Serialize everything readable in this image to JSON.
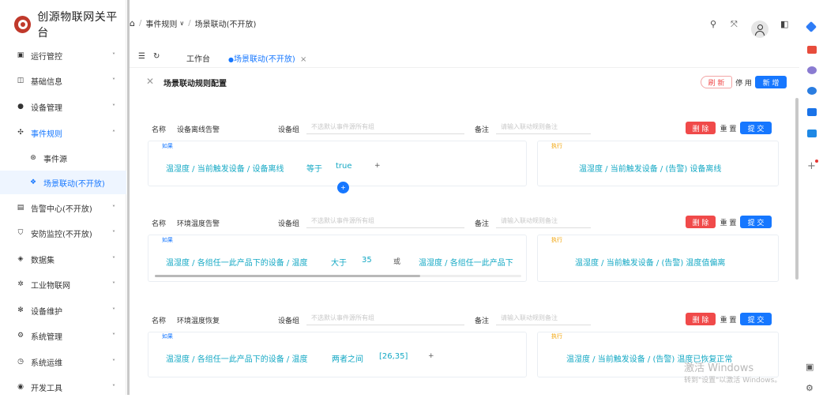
{
  "app": {
    "title": "创源物联网关平台"
  },
  "sidebar": {
    "items": [
      {
        "label": "运行管控",
        "icon": "monitor-icon",
        "chevron": "˅"
      },
      {
        "label": "基础信息",
        "icon": "image-icon",
        "chevron": "˅"
      },
      {
        "label": "设备管理",
        "icon": "device-icon",
        "chevron": "˅"
      },
      {
        "label": "事件规则",
        "icon": "rule-icon",
        "chevron": "˄"
      },
      {
        "label": "事件源",
        "icon": "source-icon",
        "chevron": ""
      },
      {
        "label": "场景联动(不开放)",
        "icon": "scene-icon",
        "chevron": ""
      },
      {
        "label": "告警中心(不开放)",
        "icon": "alarm-icon",
        "chevron": "˅"
      },
      {
        "label": "安防监控(不开放)",
        "icon": "shield-icon",
        "chevron": "˅"
      },
      {
        "label": "数据集",
        "icon": "layers-icon",
        "chevron": "˅"
      },
      {
        "label": "工业物联网",
        "icon": "gear-icon",
        "chevron": "˅"
      },
      {
        "label": "设备维护",
        "icon": "settings-icon",
        "chevron": "˅"
      },
      {
        "label": "系统管理",
        "icon": "system-icon",
        "chevron": "˅"
      },
      {
        "label": "系统运维",
        "icon": "ops-icon",
        "chevron": "˅"
      },
      {
        "label": "开发工具",
        "icon": "dev-icon",
        "chevron": "˅"
      }
    ]
  },
  "header": {
    "breadcrumb": [
      "事件规则",
      "场景联动(不开放)"
    ],
    "breadcrumb_chevron": "∨"
  },
  "tabs": {
    "workbench": "工作台",
    "active": "场景联动(不开放)",
    "close": "×"
  },
  "panel": {
    "title": "场景联动规则配置",
    "refresh": "刷 新",
    "disable": "停 用",
    "add": "新 增"
  },
  "labels": {
    "name": "名称",
    "group": "设备组",
    "remark": "备注",
    "if": "如果",
    "then": "执行",
    "delete": "删 除",
    "reset": "重 置",
    "submit": "提 交",
    "group_placeholder": "不选默认事件源所有组",
    "remark_placeholder": "请输入联动规则备注"
  },
  "rules": [
    {
      "name": "设备离线告警",
      "conditions": [
        "温湿度 / 当前触发设备 / 设备离线",
        "等于",
        "true",
        "+"
      ],
      "action": "温湿度 / 当前触发设备 / (告警) 设备离线"
    },
    {
      "name": "环境温度告警",
      "conditions": [
        "温湿度 / 各组任一此产品下的设备 / 温度",
        "大于",
        "35",
        "或",
        "温湿度 / 各组任一此产品下"
      ],
      "action": "温湿度 / 当前触发设备 / (告警) 温度值偏离"
    },
    {
      "name": "环境温度恢复",
      "conditions": [
        "温湿度 / 各组任一此产品下的设备 / 温度",
        "两者之间",
        "[26,35]",
        "+"
      ],
      "action": "温湿度 / 当前触发设备 / (告警) 温度已恢复正常"
    }
  ],
  "watermark": {
    "line1": "激活 Windows",
    "line2": "转到\"设置\"以激活 Windows。"
  },
  "colors": {
    "accent": "#1677ff",
    "danger": "#f04a4a",
    "cyan": "#13a8c4",
    "orange": "#f0a000"
  }
}
